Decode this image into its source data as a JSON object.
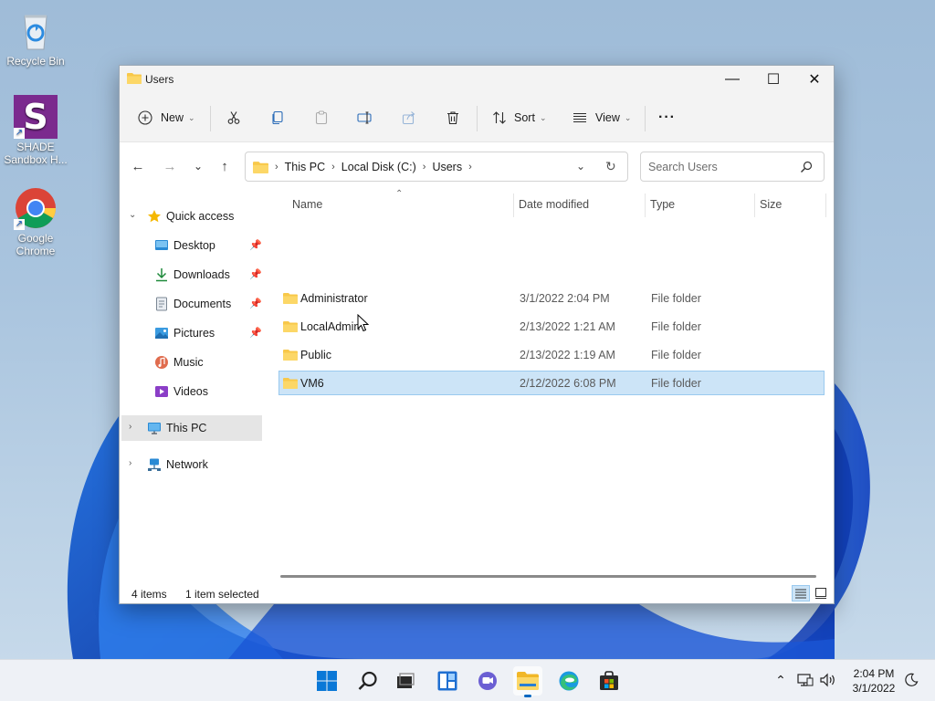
{
  "desktop": {
    "icons": [
      {
        "label_line1": "Recycle Bin",
        "label_line2": "",
        "icon": "recycle-bin-icon"
      },
      {
        "label_line1": "SHADE",
        "label_line2": "Sandbox H...",
        "icon": "shade-sandbox-icon",
        "glyph_letter": "S"
      },
      {
        "label_line1": "Google",
        "label_line2": "Chrome",
        "icon": "chrome-icon"
      }
    ]
  },
  "window": {
    "title": "Users",
    "controls": {
      "minimize": "—",
      "maximize": "☐",
      "close": "✕"
    }
  },
  "toolbar": {
    "new_label": "New",
    "sort_label": "Sort",
    "view_label": "View",
    "more_label": "···",
    "icons": [
      "cut-icon",
      "copy-icon",
      "paste-icon",
      "rename-icon",
      "share-icon",
      "delete-icon"
    ]
  },
  "navigation": {
    "back": "←",
    "forward": "→",
    "recent": "⌄",
    "up": "↑",
    "breadcrumb": [
      "This PC",
      "Local Disk (C:)",
      "Users"
    ],
    "search_placeholder": "Search Users"
  },
  "sidebar": {
    "quick_access": {
      "label": "Quick access",
      "items": [
        {
          "label": "Desktop",
          "icon": "desktop-icon",
          "pinned": true
        },
        {
          "label": "Downloads",
          "icon": "downloads-icon",
          "pinned": true
        },
        {
          "label": "Documents",
          "icon": "documents-icon",
          "pinned": true
        },
        {
          "label": "Pictures",
          "icon": "pictures-icon",
          "pinned": true
        },
        {
          "label": "Music",
          "icon": "music-icon",
          "pinned": false
        },
        {
          "label": "Videos",
          "icon": "videos-icon",
          "pinned": false
        }
      ]
    },
    "this_pc": {
      "label": "This PC"
    },
    "network": {
      "label": "Network"
    }
  },
  "file_list": {
    "columns": [
      "Name",
      "Date modified",
      "Type",
      "Size"
    ],
    "rows": [
      {
        "name": "Administrator",
        "date": "3/1/2022 2:04 PM",
        "type": "File folder",
        "size": "",
        "selected": false
      },
      {
        "name": "LocalAdmin",
        "date": "2/13/2022 1:21 AM",
        "type": "File folder",
        "size": "",
        "selected": false
      },
      {
        "name": "Public",
        "date": "2/13/2022 1:19 AM",
        "type": "File folder",
        "size": "",
        "selected": false
      },
      {
        "name": "VM6",
        "date": "2/12/2022 6:08 PM",
        "type": "File folder",
        "size": "",
        "selected": true
      }
    ]
  },
  "status": {
    "item_count": "4 items",
    "selection": "1 item selected"
  },
  "taskbar": {
    "apps": [
      "start-icon",
      "search-icon",
      "task-view-icon",
      "widgets-icon",
      "chat-icon",
      "file-explorer-icon",
      "edge-icon",
      "store-icon"
    ],
    "active_app": "file-explorer-icon",
    "clock_time": "2:04 PM",
    "clock_date": "3/1/2022"
  },
  "colors": {
    "accent": "#0067c0",
    "selection_bg": "#cce4f7",
    "selection_border": "#99c9ef",
    "folder_yellow": "#f8c84a"
  }
}
